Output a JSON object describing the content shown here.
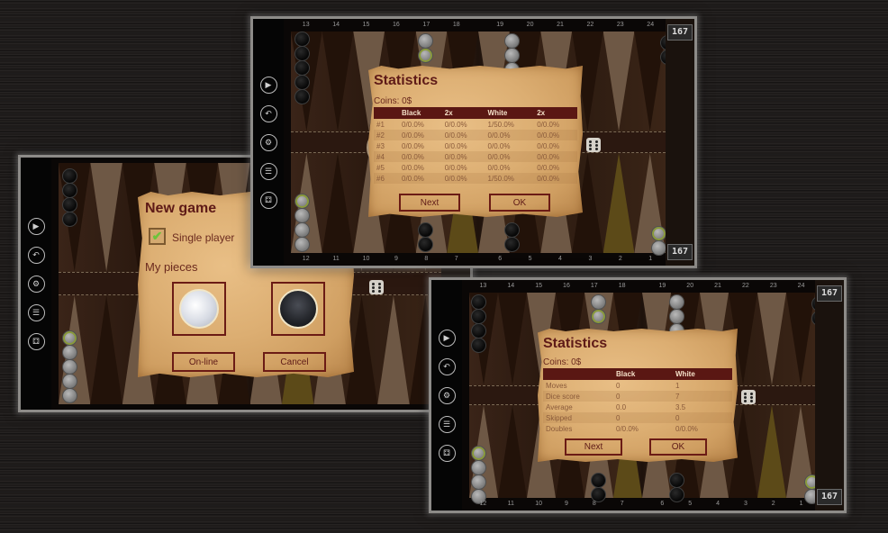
{
  "screens": [
    {
      "id": "new-game",
      "score_top": "",
      "rail_icons": [
        "play-icon",
        "undo-icon",
        "settings-icon",
        "list-icon",
        "dice-icon"
      ],
      "dialog": {
        "title": "New game",
        "single_player_label": "Single player",
        "single_player_checked": true,
        "my_pieces_label": "My pieces",
        "pieces": [
          "white",
          "black"
        ],
        "online_button": "On-line",
        "cancel_button": "Cancel"
      }
    },
    {
      "id": "statistics-detailed",
      "top_numbers": [
        "13",
        "14",
        "15",
        "16",
        "17",
        "18",
        "19",
        "20",
        "21",
        "22",
        "23",
        "24"
      ],
      "bottom_numbers": [
        "12",
        "11",
        "10",
        "9",
        "8",
        "7",
        "6",
        "5",
        "4",
        "3",
        "2",
        "1"
      ],
      "score_top": "167",
      "score_bottom": "167",
      "rail_icons": [
        "play-icon",
        "undo-icon",
        "settings-icon",
        "list-icon",
        "dice-icon"
      ],
      "dialog": {
        "title": "Statistics",
        "coins": "Coins: 0$",
        "headers": [
          "",
          "Black",
          "2x",
          "White",
          "2x"
        ],
        "rows": [
          [
            "#1",
            "0/0.0%",
            "0/0.0%",
            "1/50.0%",
            "0/0.0%"
          ],
          [
            "#2",
            "0/0.0%",
            "0/0.0%",
            "0/0.0%",
            "0/0.0%"
          ],
          [
            "#3",
            "0/0.0%",
            "0/0.0%",
            "0/0.0%",
            "0/0.0%"
          ],
          [
            "#4",
            "0/0.0%",
            "0/0.0%",
            "0/0.0%",
            "0/0.0%"
          ],
          [
            "#5",
            "0/0.0%",
            "0/0.0%",
            "0/0.0%",
            "0/0.0%"
          ],
          [
            "#6",
            "0/0.0%",
            "0/0.0%",
            "1/50.0%",
            "0/0.0%"
          ]
        ],
        "next_button": "Next",
        "ok_button": "OK"
      }
    },
    {
      "id": "statistics-summary",
      "top_numbers": [
        "13",
        "14",
        "15",
        "16",
        "17",
        "18",
        "19",
        "20",
        "21",
        "22",
        "23",
        "24"
      ],
      "bottom_numbers": [
        "12",
        "11",
        "10",
        "9",
        "8",
        "7",
        "6",
        "5",
        "4",
        "3",
        "2",
        "1"
      ],
      "score_top": "167",
      "score_bottom": "167",
      "rail_icons": [
        "play-icon",
        "undo-icon",
        "settings-icon",
        "list-icon",
        "dice-icon"
      ],
      "dialog": {
        "title": "Statistics",
        "coins": "Coins: 0$",
        "headers": [
          "",
          "Black",
          "White"
        ],
        "rows": [
          [
            "Moves",
            "0",
            "1"
          ],
          [
            "Dice score",
            "0",
            "7"
          ],
          [
            "Average",
            "0.0",
            "3.5"
          ],
          [
            "Skipped",
            "0",
            "0"
          ],
          [
            "Doubles",
            "0/0.0%",
            "0/0.0%"
          ]
        ],
        "next_button": "Next",
        "ok_button": "OK"
      }
    }
  ],
  "colors": {
    "parchment": "#dcae72",
    "dialog_accent": "#5a1713",
    "checkmark": "#6cc43a"
  }
}
